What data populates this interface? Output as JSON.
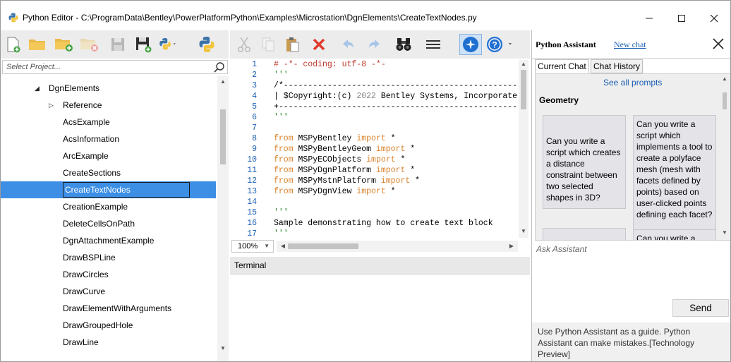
{
  "window": {
    "title": "Python Editor - C:\\ProgramData\\Bentley\\PowerPlatformPython\\Examples\\Microstation\\DgnElements\\CreateTextNodes.py",
    "minimize_icon": "minimize-icon",
    "maximize_icon": "maximize-icon",
    "close_icon": "close-icon"
  },
  "project": {
    "search_placeholder": "Select Project...",
    "tree": [
      {
        "label": "DgnElements",
        "level": 0,
        "expanded": true
      },
      {
        "label": "Reference",
        "level": 1,
        "expandable": true
      },
      {
        "label": "AcsExample",
        "level": 1
      },
      {
        "label": "AcsInformation",
        "level": 1
      },
      {
        "label": "ArcExample",
        "level": 1
      },
      {
        "label": "CreateSections",
        "level": 1
      },
      {
        "label": "CreateTextNodes",
        "level": 1,
        "selected": true
      },
      {
        "label": "CreationExample",
        "level": 1
      },
      {
        "label": "DeleteCellsOnPath",
        "level": 1
      },
      {
        "label": "DgnAttachmentExample",
        "level": 1
      },
      {
        "label": "DrawBSPLine",
        "level": 1
      },
      {
        "label": "DrawCircles",
        "level": 1
      },
      {
        "label": "DrawCurve",
        "level": 1
      },
      {
        "label": "DrawElementWithArguments",
        "level": 1
      },
      {
        "label": "DrawGroupedHole",
        "level": 1
      },
      {
        "label": "DrawLine",
        "level": 1
      }
    ]
  },
  "editor": {
    "line_numbers": [
      "1",
      "2",
      "3",
      "4",
      "5",
      "6",
      "7",
      "8",
      "9",
      "10",
      "11",
      "12",
      "13",
      "14",
      "15",
      "16",
      "17"
    ],
    "lines": {
      "l1": "# -*- coding: utf-8 -*-",
      "l2": "'''",
      "l3": "/*--------------------------------------------------------------------",
      "l4a": "| $Copyright:(c) ",
      "l4b": "2022",
      "l4c": " Bentley Systems, Incorporated",
      "l5": "+--------------------------------------------------------------------",
      "l6": "'''",
      "l8a": "from",
      "l8b": " MSPyBentley ",
      "l8c": "import",
      "l8d": " *",
      "l9a": "from",
      "l9b": " MSPyBentleyGeom ",
      "l9c": "import",
      "l9d": " *",
      "l10a": "from",
      "l10b": " MSPyECObjects ",
      "l10c": "import",
      "l10d": " *",
      "l11a": "from",
      "l11b": " MSPyDgnPlatform ",
      "l11c": "import",
      "l11d": " *",
      "l12a": "from",
      "l12b": " MSPyMstnPlatform ",
      "l12c": "import",
      "l12d": " *",
      "l13a": "from",
      "l13b": " MSPyDgnView ",
      "l13c": "import",
      "l13d": " *",
      "l15": "'''",
      "l16": "Sample demonstrating how to create text block",
      "l17": "'''"
    },
    "zoom": "100%",
    "terminal_label": "Terminal"
  },
  "assistant": {
    "title": "Python Assistant",
    "new_chat": "New chat",
    "tabs": [
      "Current Chat",
      "Chat History"
    ],
    "see_all": "See all prompts",
    "category": "Geometry",
    "cards": [
      "Can you write a script which creates a distance constraint between two selected shapes in 3D?",
      "Can you write a script which implements a tool to create a polyface mesh (mesh with facets defined by points) based on user-clicked points defining each facet?",
      "",
      "Can you write a"
    ],
    "ask_placeholder": "Ask Assistant",
    "send": "Send",
    "disclaimer": "Use Python Assistant as a guide. Python Assistant can make mistakes.[Technology Preview]"
  },
  "colors": {
    "selection": "#3d8fe6",
    "keyword": "#d9822b",
    "comment": "#c0392b",
    "string": "#2a8a2a",
    "line_number": "#1a5fb4",
    "link": "#1a5fb4"
  }
}
